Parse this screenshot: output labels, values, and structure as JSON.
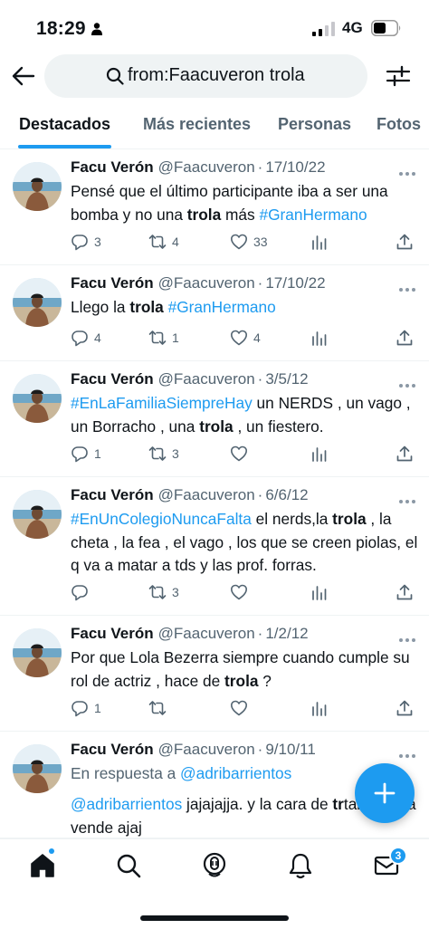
{
  "status_bar": {
    "time": "18:29",
    "network": "4G"
  },
  "search": {
    "query": "from:Faacuveron trola"
  },
  "tabs": [
    {
      "label": "Destacados"
    },
    {
      "label": "Más recientes"
    },
    {
      "label": "Personas"
    },
    {
      "label": "Fotos"
    }
  ],
  "tweets": [
    {
      "name": "Facu Verón",
      "handle": "@Faacuveron",
      "date": "17/10/22",
      "text_segments": [
        {
          "text": "Pensé que el último participante iba a ser una bomba y no una ",
          "style": "plain"
        },
        {
          "text": "trola",
          "style": "kw"
        },
        {
          "text": " más ",
          "style": "plain"
        },
        {
          "text": "#GranHermano",
          "style": "tag"
        }
      ],
      "replies": "3",
      "retweets": "4",
      "likes": "33"
    },
    {
      "name": "Facu Verón",
      "handle": "@Faacuveron",
      "date": "17/10/22",
      "text_segments": [
        {
          "text": "Llego la ",
          "style": "plain"
        },
        {
          "text": "trola",
          "style": "kw"
        },
        {
          "text": " ",
          "style": "plain"
        },
        {
          "text": "#GranHermano",
          "style": "tag"
        }
      ],
      "replies": "4",
      "retweets": "1",
      "likes": "4"
    },
    {
      "name": "Facu Verón",
      "handle": "@Faacuveron",
      "date": "3/5/12",
      "text_segments": [
        {
          "text": "#EnLaFamiliaSiempreHay",
          "style": "tag"
        },
        {
          "text": " un NERDS ,  un vago , un Borracho , una ",
          "style": "plain"
        },
        {
          "text": "trola",
          "style": "kw"
        },
        {
          "text": " , un fiestero.",
          "style": "plain"
        }
      ],
      "replies": "1",
      "retweets": "3",
      "likes": ""
    },
    {
      "name": "Facu Verón",
      "handle": "@Faacuveron",
      "date": "6/6/12",
      "text_segments": [
        {
          "text": "#EnUnColegioNuncaFalta",
          "style": "tag"
        },
        {
          "text": " el nerds,la ",
          "style": "plain"
        },
        {
          "text": "trola",
          "style": "kw"
        },
        {
          "text": " , la cheta , la fea , el vago , los que se creen piolas, el q va a matar a tds y las prof. forras.",
          "style": "plain"
        }
      ],
      "replies": "",
      "retweets": "3",
      "likes": ""
    },
    {
      "name": "Facu Verón",
      "handle": "@Faacuveron",
      "date": "1/2/12",
      "text_segments": [
        {
          "text": "Por que Lola Bezerra siempre cuando cumple su rol de actriz , hace de ",
          "style": "plain"
        },
        {
          "text": "trola",
          "style": "kw"
        },
        {
          "text": " ?",
          "style": "plain"
        }
      ],
      "replies": "1",
      "retweets": "",
      "likes": ""
    },
    {
      "name": "Facu Verón",
      "handle": "@Faacuveron",
      "date": "9/10/11",
      "reply_to_prefix": "En respuesta a ",
      "reply_to_handle": "@adribarrientos",
      "text_segments": [
        {
          "text": "@adribarrientos",
          "style": "mention"
        },
        {
          "text": " jajajajja. y la cara de ",
          "style": "plain"
        },
        {
          "text": "tr",
          "style": "kw"
        },
        {
          "text": "también la vende ajaj",
          "style": "plain"
        }
      ]
    }
  ],
  "bottom_nav": {
    "messages_badge": "3"
  },
  "colors": {
    "accent": "#1d9bf0",
    "text": "#0f1419",
    "muted": "#536471"
  },
  "icons": [
    "back-arrow-icon",
    "search-icon",
    "filter-icon",
    "reply-icon",
    "retweet-icon",
    "like-icon",
    "views-icon",
    "share-icon",
    "more-icon",
    "compose-icon",
    "home-icon",
    "explore-icon",
    "spaces-icon",
    "notifications-icon",
    "messages-icon"
  ]
}
